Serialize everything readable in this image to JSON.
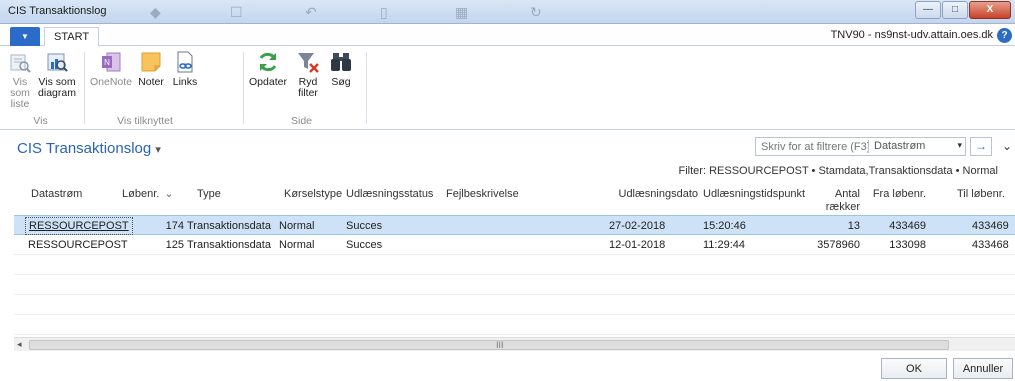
{
  "window": {
    "title": "CIS Transaktionslog",
    "min_glyph": "—",
    "max_glyph": "□",
    "close_glyph": "X"
  },
  "tabs": {
    "app_glyph": "▼",
    "start": "START",
    "server": "TNV90 - ns9nst-udv.attain.oes.dk",
    "help_glyph": "?"
  },
  "ribbon": {
    "vis_som_liste": "Vis som liste",
    "vis_som_diagram": "Vis som diagram",
    "group_vis": "Vis",
    "onenote": "OneNote",
    "noter": "Noter",
    "links": "Links",
    "group_vis_tilknyttet": "Vis tilknyttet",
    "opdater": "Opdater",
    "ryd_filter": "Ryd filter",
    "sog": "Søg",
    "group_side": "Side"
  },
  "page": {
    "title": "CIS Transaktionslog",
    "title_arrow": "▾",
    "search_placeholder": "Skriv for at filtrere (F3)",
    "search_field": "Datastrøm",
    "search_dropdown": "▾",
    "go_glyph": "→",
    "collapse_glyph": "⌄",
    "filter": "Filter: RESSOURCEPOST • Stamdata,Transaktionsdata • Normal"
  },
  "grid": {
    "columns": {
      "datastrom": "Datastrøm",
      "lobenr": "Løbenr.",
      "sort_glyph": "⌄",
      "type": "Type",
      "korselstype": "Kørselstype",
      "udlaesningsstatus": "Udlæsningsstatus",
      "fejlbeskrivelse": "Fejlbeskrivelse",
      "udlaesningsdato": "Udlæsningsdato",
      "udlaesningstidspunkt": "Udlæsningstidspunkt",
      "antal_raekker": "Antal rækker udlæst",
      "fra_lobenr": "Fra løbenr.",
      "til_lobenr": "Til løbenr."
    },
    "rows": [
      {
        "datastrom": "RESSOURCEPOST",
        "lobenr": "174",
        "type": "Transaktionsdata",
        "korselstype": "Normal",
        "status": "Succes",
        "fejl": "",
        "dato": "27-02-2018",
        "tid": "15:20:46",
        "antal": "13",
        "fra": "433469",
        "til": "433469"
      },
      {
        "datastrom": "RESSOURCEPOST",
        "lobenr": "125",
        "type": "Transaktionsdata",
        "korselstype": "Normal",
        "status": "Succes",
        "fejl": "",
        "dato": "12-01-2018",
        "tid": "11:29:44",
        "antal": "3578960",
        "fra": "133098",
        "til": "433468"
      }
    ]
  },
  "scroll": {
    "left_glyph": "◂",
    "grip": "III"
  },
  "buttons": {
    "ok": "OK",
    "annuller": "Annuller"
  },
  "colors": {
    "accent": "#2a6cc8",
    "title": "#2a64b5",
    "selection": "#cde2f6",
    "refresh": "#3aa14a",
    "filter_x": "#d23b2a"
  }
}
